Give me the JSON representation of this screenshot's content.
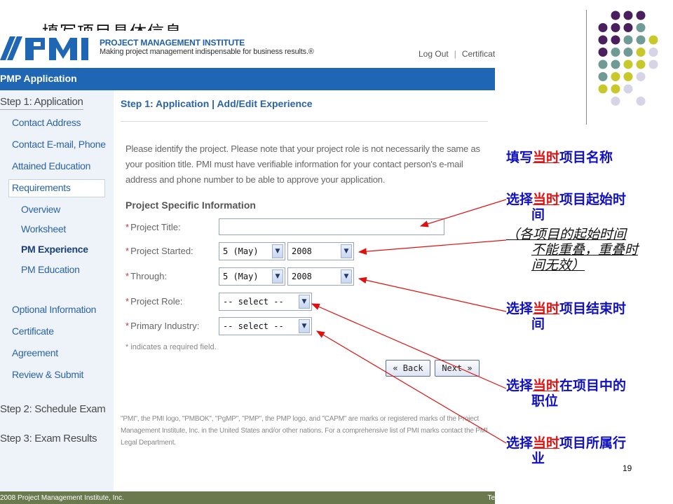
{
  "slide": {
    "title": "填写项目具体信息",
    "page_number": "19"
  },
  "header": {
    "org_name": "PROJECT MANAGEMENT INSTITUTE",
    "tagline": "Making project management indispensable for business results.®",
    "logout": "Log Out",
    "certification": "Certificat"
  },
  "app_bar": {
    "title": "PMP Application"
  },
  "sidebar": {
    "step1": "Step 1: Application",
    "items": [
      "Contact Address",
      "Contact E-mail, Phone",
      "Attained Education",
      "Requirements"
    ],
    "sub_items": [
      "Overview",
      "Worksheet",
      "PM Experience",
      "PM Education"
    ],
    "lower_items": [
      "Optional Information",
      "Certificate",
      "Agreement",
      "Review & Submit"
    ],
    "step2": "Step 2: Schedule Exam",
    "step3": "Step 3: Exam Results"
  },
  "main": {
    "title": "Step 1: Application | Add/Edit Experience",
    "intro": "Please identify the project. Please note that your project role is not necessarily the same as your position title. PMI must have verifiable information for your contact person's e-mail address and phone number to be able to approve your application.",
    "section_heading": "Project Specific Information",
    "fields": {
      "project_title_label": "Project Title:",
      "project_title_value": "",
      "project_started_label": "Project Started:",
      "started_month": "5 (May)",
      "started_year": "2008",
      "through_label": "Through:",
      "through_month": "5 (May)",
      "through_year": "2008",
      "project_role_label": "Project Role:",
      "project_role_value": "-- select --",
      "primary_industry_label": "Primary Industry:",
      "primary_industry_value": "-- select --"
    },
    "required_note": "* indicates a required field.",
    "back_button": "« Back",
    "next_button": "Next »",
    "footer_note": "\"PMI\", the PMI logo, \"PMBOK\", \"PgMP\", \"PMP\", the PMP logo, and \"CAPM\" are marks or registered marks of the Project Management Institute, Inc. in the United States and/or other nations. For a comprehensive list of PMI marks contact the PMI Legal Department."
  },
  "footer": {
    "copyright": "2008 Project Management Institute, Inc.",
    "right": "Te"
  },
  "annotations": {
    "hl": "当时",
    "a1_pre": "填写",
    "a1_post": "项目名称",
    "a2_pre": "选择",
    "a2_post": "项目起始时",
    "a2_line2": "间",
    "a3_line1": "（各项目的起始时间",
    "a3_line2": "不能重叠，重叠时",
    "a3_line3": "间无效）",
    "a4_pre": "选择",
    "a4_post": "项目结束时",
    "a4_line2": "间",
    "a5_pre": "选择",
    "a5_post": "在项目中的",
    "a5_line2": "职位",
    "a6_pre": "选择",
    "a6_post": "项目所属行",
    "a6_line2": "业"
  },
  "colors": {
    "brand_blue": "#1f66b5",
    "annotation_blue": "#1010c0",
    "annotation_red": "#e01010",
    "dot_purple": "#4a1f5e",
    "dot_teal": "#6f9a96",
    "dot_olive": "#c8c82a",
    "dot_lavender": "#d6d4e6"
  }
}
